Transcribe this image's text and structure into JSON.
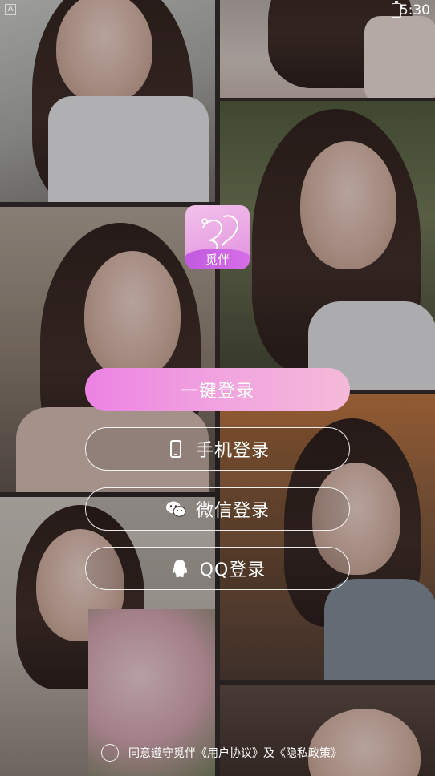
{
  "status_bar": {
    "left_badge": "A",
    "time": "5:30",
    "battery_icon": "battery-icon"
  },
  "app": {
    "logo_text": "觅伴"
  },
  "buttons": {
    "one_click": "一键登录",
    "phone": "手机登录",
    "phone_icon": "phone-icon",
    "wechat": "微信登录",
    "wechat_icon": "wechat-icon",
    "qq": "QQ登录",
    "qq_icon": "qq-icon"
  },
  "agreement": {
    "text": "同意遵守觅伴《用户协议》及《隐私政策》"
  },
  "colors": {
    "primary_gradient_start": "#ec82e3",
    "primary_gradient_end": "#f4b9d8",
    "logo_band": "#c25ae0"
  }
}
